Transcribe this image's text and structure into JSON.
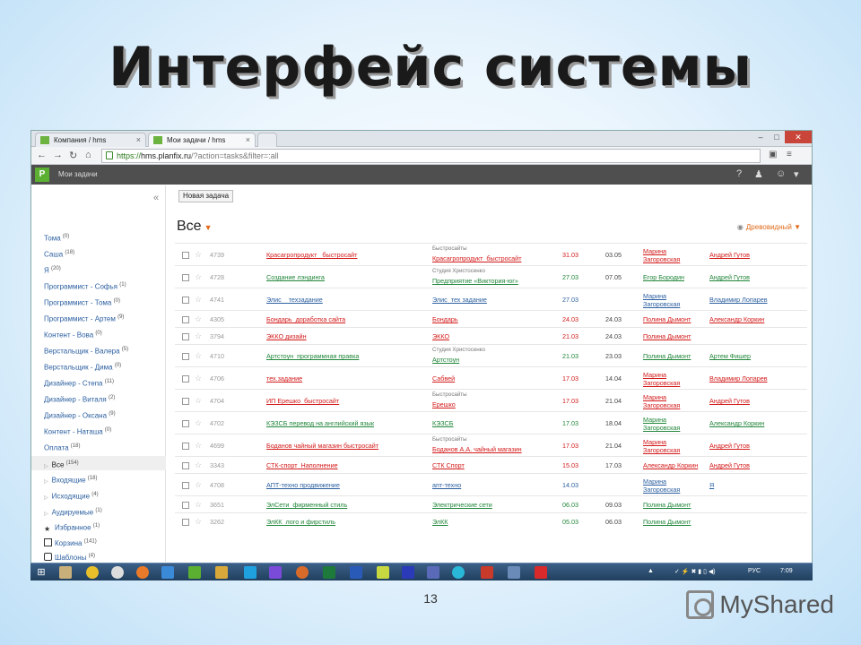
{
  "slide": {
    "title": "Интерфейс системы",
    "page_number": "13",
    "logo_text": "MyShared"
  },
  "browser": {
    "tabs": [
      {
        "label": "Компания / hms",
        "active": false
      },
      {
        "label": "Мои задачи / hms",
        "active": true
      }
    ],
    "url_scheme": "https://",
    "url_host": "hms.planfix.ru",
    "url_path": "/?action=tasks&filter=:all",
    "window_controls": [
      "–",
      "□",
      "✕"
    ]
  },
  "app": {
    "section": "Мои задачи",
    "new_task_label": "Новая задача",
    "filter_title": "Все",
    "view_label": "Древовидный",
    "collapse_icon": "«"
  },
  "sidebar": {
    "items": [
      {
        "label": "Тома",
        "count": "(0)"
      },
      {
        "label": "Саша",
        "count": "(18)"
      },
      {
        "label": "Я",
        "count": "(20)"
      },
      {
        "label": "Программист - Софья",
        "count": "(1)"
      },
      {
        "label": "Программист - Тома",
        "count": "(0)"
      },
      {
        "label": "Программист - Артем",
        "count": "(9)"
      },
      {
        "label": "Контент - Вова",
        "count": "(0)"
      },
      {
        "label": "Верстальщик - Валера",
        "count": "(5)"
      },
      {
        "label": "Верстальщик - Дима",
        "count": "(0)"
      },
      {
        "label": "Дизайнер - Степа",
        "count": "(11)"
      },
      {
        "label": "Дизайнер - Виталя",
        "count": "(2)"
      },
      {
        "label": "Дизайнер - Оксана",
        "count": "(9)"
      },
      {
        "label": "Контент - Наташа",
        "count": "(0)"
      },
      {
        "label": "Оплата",
        "count": "(18)"
      },
      {
        "label": "Все",
        "count": "(154)"
      },
      {
        "label": "Входящие",
        "count": "(18)"
      },
      {
        "label": "Исходящие",
        "count": "(4)"
      },
      {
        "label": "Аудируемые",
        "count": "(1)"
      },
      {
        "label": "Избранное",
        "count": "(1)"
      },
      {
        "label": "Корзина",
        "count": "(141)"
      },
      {
        "label": "Шаблоны",
        "count": "(4)"
      }
    ]
  },
  "tasks": [
    {
      "num": "4739",
      "title": "Красагропродукт _быстросайт",
      "project_top": "Быстросайты",
      "project": "Красагропродукт_быстросайт",
      "d1": "31.03",
      "d2": "03.05",
      "owner": "Марина Загоровская",
      "executor": "Андрей Гутов",
      "color": "red"
    },
    {
      "num": "4728",
      "title": "Создание лэндинга",
      "project_top": "Студия Христосенко",
      "project": "Предприятие «Виктория-юг»",
      "d1": "27.03",
      "d2": "07.05",
      "owner": "Егор Бородин",
      "executor": "Андрей Гутов",
      "color": "green"
    },
    {
      "num": "4741",
      "title": "Элис _ техзадание",
      "project_top": "",
      "project": "Элис_тех задание",
      "d1": "27.03",
      "d2": "",
      "owner": "Марина Загоровская",
      "executor": "Владимир Лопарев",
      "color": "blue"
    },
    {
      "num": "4305",
      "title": "Бондарь_доработка сайта",
      "project_top": "",
      "project": "Бондарь",
      "d1": "24.03",
      "d2": "24.03",
      "owner": "Полина Дымонт",
      "executor": "Александр Коркин",
      "color": "red"
    },
    {
      "num": "3794",
      "title": "ЭККО дизайн",
      "project_top": "",
      "project": "ЭККО",
      "d1": "21.03",
      "d2": "24.03",
      "owner": "Полина Дымонт",
      "executor": "",
      "color": "red"
    },
    {
      "num": "4710",
      "title": "Артстоун_программная правка",
      "project_top": "Студия Христосенко",
      "project": "Артстоун",
      "d1": "21.03",
      "d2": "23.03",
      "owner": "Полина Дымонт",
      "executor": "Артем Фишер",
      "color": "green"
    },
    {
      "num": "4706",
      "title": "тех.задание",
      "project_top": "",
      "project": "Сабвей",
      "d1": "17.03",
      "d2": "14.04",
      "owner": "Марина Загоровская",
      "executor": "Владимир Лопарев",
      "color": "red"
    },
    {
      "num": "4704",
      "title": "ИП Ерешко_быстросайт",
      "project_top": "Быстросайты",
      "project": "Ерешко",
      "d1": "17.03",
      "d2": "21.04",
      "owner": "Марина Загоровская",
      "executor": "Андрей Гутов",
      "color": "red"
    },
    {
      "num": "4702",
      "title": "КЭЗСБ перевод на английский язык",
      "project_top": "",
      "project": "КЭЗСБ",
      "d1": "17.03",
      "d2": "18.04",
      "owner": "Марина Загоровская",
      "executor": "Александр Коркин",
      "color": "green"
    },
    {
      "num": "4699",
      "title": "Боданов чайный магазин быстросайт",
      "project_top": "Быстросайты",
      "project": "Боданов А.А. чайный магазин",
      "d1": "17.03",
      "d2": "21.04",
      "owner": "Марина Загоровская",
      "executor": "Андрей Гутов",
      "color": "red"
    },
    {
      "num": "3343",
      "title": "СТК-спорт_Наполнение",
      "project_top": "",
      "project": "СТК Спорт",
      "d1": "15.03",
      "d2": "17.03",
      "owner": "Александр Коркин",
      "executor": "Андрей Гутов",
      "color": "red"
    },
    {
      "num": "4708",
      "title": "АПТ-техно продвижение",
      "project_top": "",
      "project": "апт-техно",
      "d1": "14.03",
      "d2": "",
      "owner": "Марина Загоровская",
      "executor": "Я",
      "color": "blue"
    },
    {
      "num": "3651",
      "title": "ЭлСети_фирменный стиль",
      "project_top": "",
      "project": "Электрические сети",
      "d1": "06.03",
      "d2": "09.03",
      "owner": "Полина Дымонт",
      "executor": "",
      "color": "green"
    },
    {
      "num": "3262",
      "title": "ЭлКК_лого и фирстиль",
      "project_top": "",
      "project": "ЭлКК",
      "d1": "05.03",
      "d2": "06.03",
      "owner": "Полина Дымонт",
      "executor": "",
      "color": "green"
    }
  ],
  "taskbar": {
    "lang": "РУС",
    "time": "7:09"
  },
  "colors": {
    "accent_orange": "#e06a1a",
    "planfix_green": "#5cb031",
    "link_red": "#d31a1a",
    "link_green": "#21863a",
    "link_blue": "#2b5fa0"
  }
}
